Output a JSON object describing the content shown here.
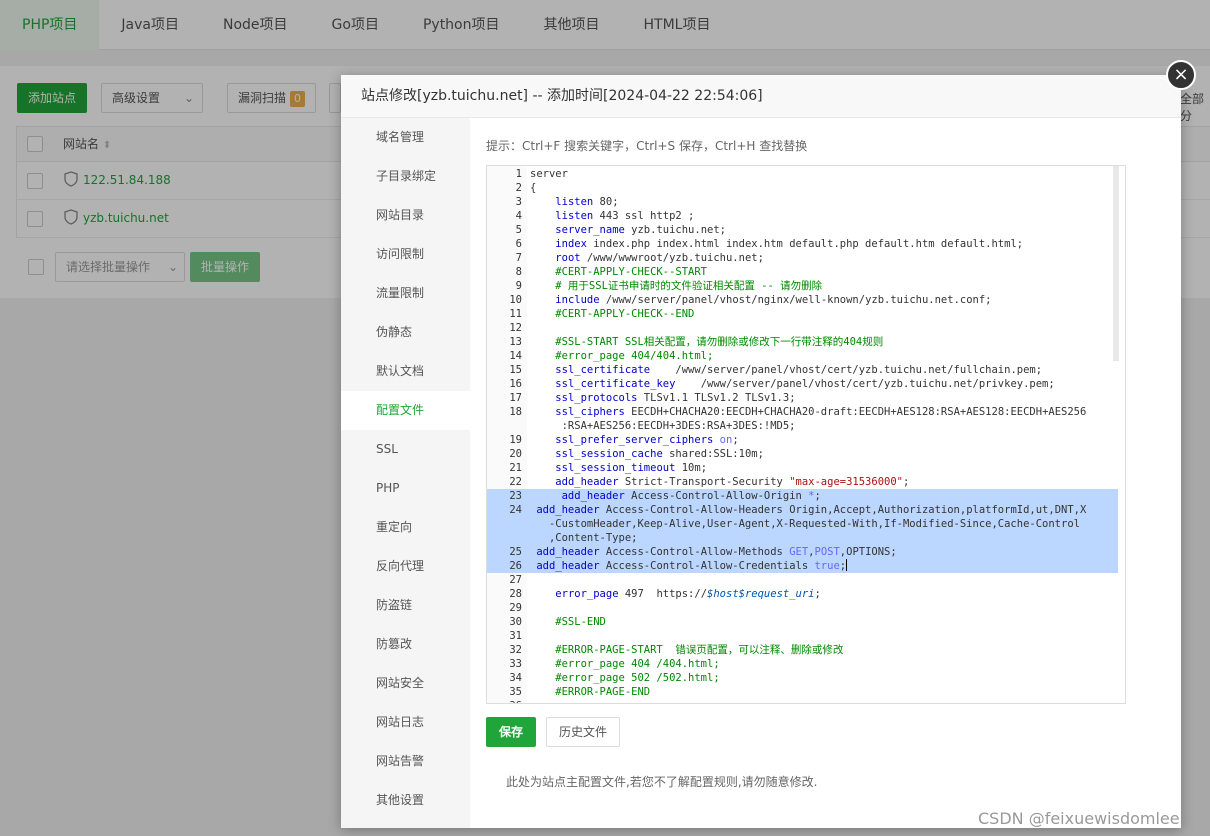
{
  "top_tabs": [
    "PHP项目",
    "Java项目",
    "Node项目",
    "Go项目",
    "Python项目",
    "其他项目",
    "HTML项目"
  ],
  "toolbar": {
    "add_site": "添加站点",
    "advanced": "高级设置",
    "vuln_scan": "漏洞扫描",
    "vuln_count": "0",
    "right_partial": "全部分"
  },
  "table": {
    "col_site": "网站名",
    "rows": [
      "122.51.84.188",
      "yzb.tuichu.net"
    ]
  },
  "batch": {
    "select_placeholder": "请选择批量操作",
    "button": "批量操作"
  },
  "modal": {
    "title": "站点修改[yzb.tuichu.net] -- 添加时间[2024-04-22 22:54:06]",
    "close": "×",
    "menu": [
      "域名管理",
      "子目录绑定",
      "网站目录",
      "访问限制",
      "流量限制",
      "伪静态",
      "默认文档",
      "配置文件",
      "SSL",
      "PHP",
      "重定向",
      "反向代理",
      "防盗链",
      "防篡改",
      "网站安全",
      "网站日志",
      "网站告警",
      "其他设置"
    ],
    "active_menu": "配置文件",
    "hint": "提示：Ctrl+F 搜索关键字，Ctrl+S 保存，Ctrl+H 查找替换",
    "save": "保存",
    "history": "历史文件",
    "note": "此处为站点主配置文件,若您不了解配置规则,请勿随意修改."
  },
  "editor": {
    "lines": [
      {
        "n": "1",
        "t": "server"
      },
      {
        "n": "2",
        "t": "{"
      },
      {
        "n": "3",
        "t": "    listen 80;"
      },
      {
        "n": "4",
        "t": "    listen 443 ssl http2 ;"
      },
      {
        "n": "5",
        "t": "    server_name yzb.tuichu.net;"
      },
      {
        "n": "6",
        "t": "    index index.php index.html index.htm default.php default.htm default.html;"
      },
      {
        "n": "7",
        "t": "    root /www/wwwroot/yzb.tuichu.net;"
      },
      {
        "n": "8",
        "t": "    #CERT-APPLY-CHECK--START"
      },
      {
        "n": "9",
        "t": "    # 用于SSL证书申请时的文件验证相关配置 -- 请勿删除"
      },
      {
        "n": "10",
        "t": "    include /www/server/panel/vhost/nginx/well-known/yzb.tuichu.net.conf;"
      },
      {
        "n": "11",
        "t": "    #CERT-APPLY-CHECK--END"
      },
      {
        "n": "12",
        "t": ""
      },
      {
        "n": "13",
        "t": "    #SSL-START SSL相关配置，请勿删除或修改下一行带注释的404规则"
      },
      {
        "n": "14",
        "t": "    #error_page 404/404.html;"
      },
      {
        "n": "15",
        "t": "    ssl_certificate    /www/server/panel/vhost/cert/yzb.tuichu.net/fullchain.pem;"
      },
      {
        "n": "16",
        "t": "    ssl_certificate_key    /www/server/panel/vhost/cert/yzb.tuichu.net/privkey.pem;"
      },
      {
        "n": "17",
        "t": "    ssl_protocols TLSv1.1 TLSv1.2 TLSv1.3;"
      },
      {
        "n": "18",
        "t": "    ssl_ciphers EECDH+CHACHA20:EECDH+CHACHA20-draft:EECDH+AES128:RSA+AES128:EECDH+AES256",
        "c": "     :RSA+AES256:EECDH+3DES:RSA+3DES:!MD5;"
      },
      {
        "n": "19",
        "t": "    ssl_prefer_server_ciphers on;"
      },
      {
        "n": "20",
        "t": "    ssl_session_cache shared:SSL:10m;"
      },
      {
        "n": "21",
        "t": "    ssl_session_timeout 10m;"
      },
      {
        "n": "22",
        "t": "    add_header Strict-Transport-Security \"max-age=31536000\";"
      },
      {
        "n": "23",
        "t": "     add_header Access-Control-Allow-Origin *;"
      },
      {
        "n": "24",
        "t": " add_header Access-Control-Allow-Headers Origin,Accept,Authorization,platformId,ut,DNT,X",
        "c": "   -CustomHeader,Keep-Alive,User-Agent,X-Requested-With,If-Modified-Since,Cache-Control",
        "c2": "   ,Content-Type;"
      },
      {
        "n": "25",
        "t": " add_header Access-Control-Allow-Methods GET,POST,OPTIONS;"
      },
      {
        "n": "26",
        "t": " add_header Access-Control-Allow-Credentials true;"
      },
      {
        "n": "27",
        "t": ""
      },
      {
        "n": "28",
        "t": "    error_page 497  https://$host$request_uri;"
      },
      {
        "n": "29",
        "t": ""
      },
      {
        "n": "30",
        "t": "    #SSL-END"
      },
      {
        "n": "31",
        "t": ""
      },
      {
        "n": "32",
        "t": "    #ERROR-PAGE-START  错误页配置，可以注释、删除或修改"
      },
      {
        "n": "33",
        "t": "    #error_page 404 /404.html;"
      },
      {
        "n": "34",
        "t": "    #error_page 502 /502.html;"
      },
      {
        "n": "35",
        "t": "    #ERROR-PAGE-END"
      },
      {
        "n": "36",
        "t": ""
      }
    ]
  },
  "watermark": "CSDN @feixuewisdomlee",
  "colors": {
    "accent": "#20a53a",
    "selection": "#bcd7ff"
  }
}
